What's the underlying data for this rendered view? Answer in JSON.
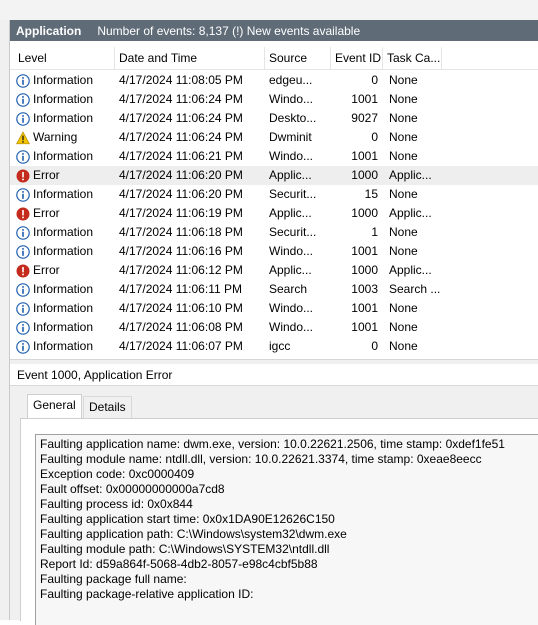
{
  "header": {
    "log_name": "Application",
    "summary": "Number of events: 8,137 (!) New events available"
  },
  "columns": {
    "level": "Level",
    "date": "Date and Time",
    "source": "Source",
    "event_id": "Event ID",
    "task": "Task Ca..."
  },
  "events": [
    {
      "level": "Information",
      "icon": "info-icon",
      "date": "4/17/2024 11:08:05 PM",
      "source": "edgeu...",
      "event_id": "0",
      "task": "None"
    },
    {
      "level": "Information",
      "icon": "info-icon",
      "date": "4/17/2024 11:06:24 PM",
      "source": "Windo...",
      "event_id": "1001",
      "task": "None"
    },
    {
      "level": "Information",
      "icon": "info-icon",
      "date": "4/17/2024 11:06:24 PM",
      "source": "Deskto...",
      "event_id": "9027",
      "task": "None"
    },
    {
      "level": "Warning",
      "icon": "warning-icon",
      "date": "4/17/2024 11:06:24 PM",
      "source": "Dwminit",
      "event_id": "0",
      "task": "None"
    },
    {
      "level": "Information",
      "icon": "info-icon",
      "date": "4/17/2024 11:06:21 PM",
      "source": "Windo...",
      "event_id": "1001",
      "task": "None"
    },
    {
      "level": "Error",
      "icon": "error-icon",
      "date": "4/17/2024 11:06:20 PM",
      "source": "Applic...",
      "event_id": "1000",
      "task": "Applic...",
      "selected": true
    },
    {
      "level": "Information",
      "icon": "info-icon",
      "date": "4/17/2024 11:06:20 PM",
      "source": "Securit...",
      "event_id": "15",
      "task": "None"
    },
    {
      "level": "Error",
      "icon": "error-icon",
      "date": "4/17/2024 11:06:19 PM",
      "source": "Applic...",
      "event_id": "1000",
      "task": "Applic..."
    },
    {
      "level": "Information",
      "icon": "info-icon",
      "date": "4/17/2024 11:06:18 PM",
      "source": "Securit...",
      "event_id": "1",
      "task": "None"
    },
    {
      "level": "Information",
      "icon": "info-icon",
      "date": "4/17/2024 11:06:16 PM",
      "source": "Windo...",
      "event_id": "1001",
      "task": "None"
    },
    {
      "level": "Error",
      "icon": "error-icon",
      "date": "4/17/2024 11:06:12 PM",
      "source": "Applic...",
      "event_id": "1000",
      "task": "Applic..."
    },
    {
      "level": "Information",
      "icon": "info-icon",
      "date": "4/17/2024 11:06:11 PM",
      "source": "Search",
      "event_id": "1003",
      "task": "Search ..."
    },
    {
      "level": "Information",
      "icon": "info-icon",
      "date": "4/17/2024 11:06:10 PM",
      "source": "Windo...",
      "event_id": "1001",
      "task": "None"
    },
    {
      "level": "Information",
      "icon": "info-icon",
      "date": "4/17/2024 11:06:08 PM",
      "source": "Windo...",
      "event_id": "1001",
      "task": "None"
    },
    {
      "level": "Information",
      "icon": "info-icon",
      "date": "4/17/2024 11:06:07 PM",
      "source": "igcc",
      "event_id": "0",
      "task": "None"
    }
  ],
  "detail": {
    "title": "Event 1000, Application Error",
    "tabs": [
      "General",
      "Details"
    ],
    "active_tab": "General",
    "lines": [
      "Faulting application name: dwm.exe, version: 10.0.22621.2506, time stamp: 0xdef1fe51",
      "Faulting module name: ntdll.dll, version: 10.0.22621.3374, time stamp: 0xeae8eecc",
      "Exception code: 0xc0000409",
      "Fault offset: 0x00000000000a7cd8",
      "Faulting process id: 0x0x844",
      "Faulting application start time: 0x0x1DA90E12626C150",
      "Faulting application path: C:\\Windows\\system32\\dwm.exe",
      "Faulting module path: C:\\Windows\\SYSTEM32\\ntdll.dll",
      "Report Id: d59a864f-5068-4db2-8057-e98c4cbf5b88",
      "Faulting package full name:",
      "Faulting package-relative application ID:"
    ]
  },
  "colors": {
    "header_bg": "#5f6b77",
    "info_blue": "#1f5fb0",
    "warning_yellow": "#f5c400",
    "error_red": "#c42b1c"
  }
}
